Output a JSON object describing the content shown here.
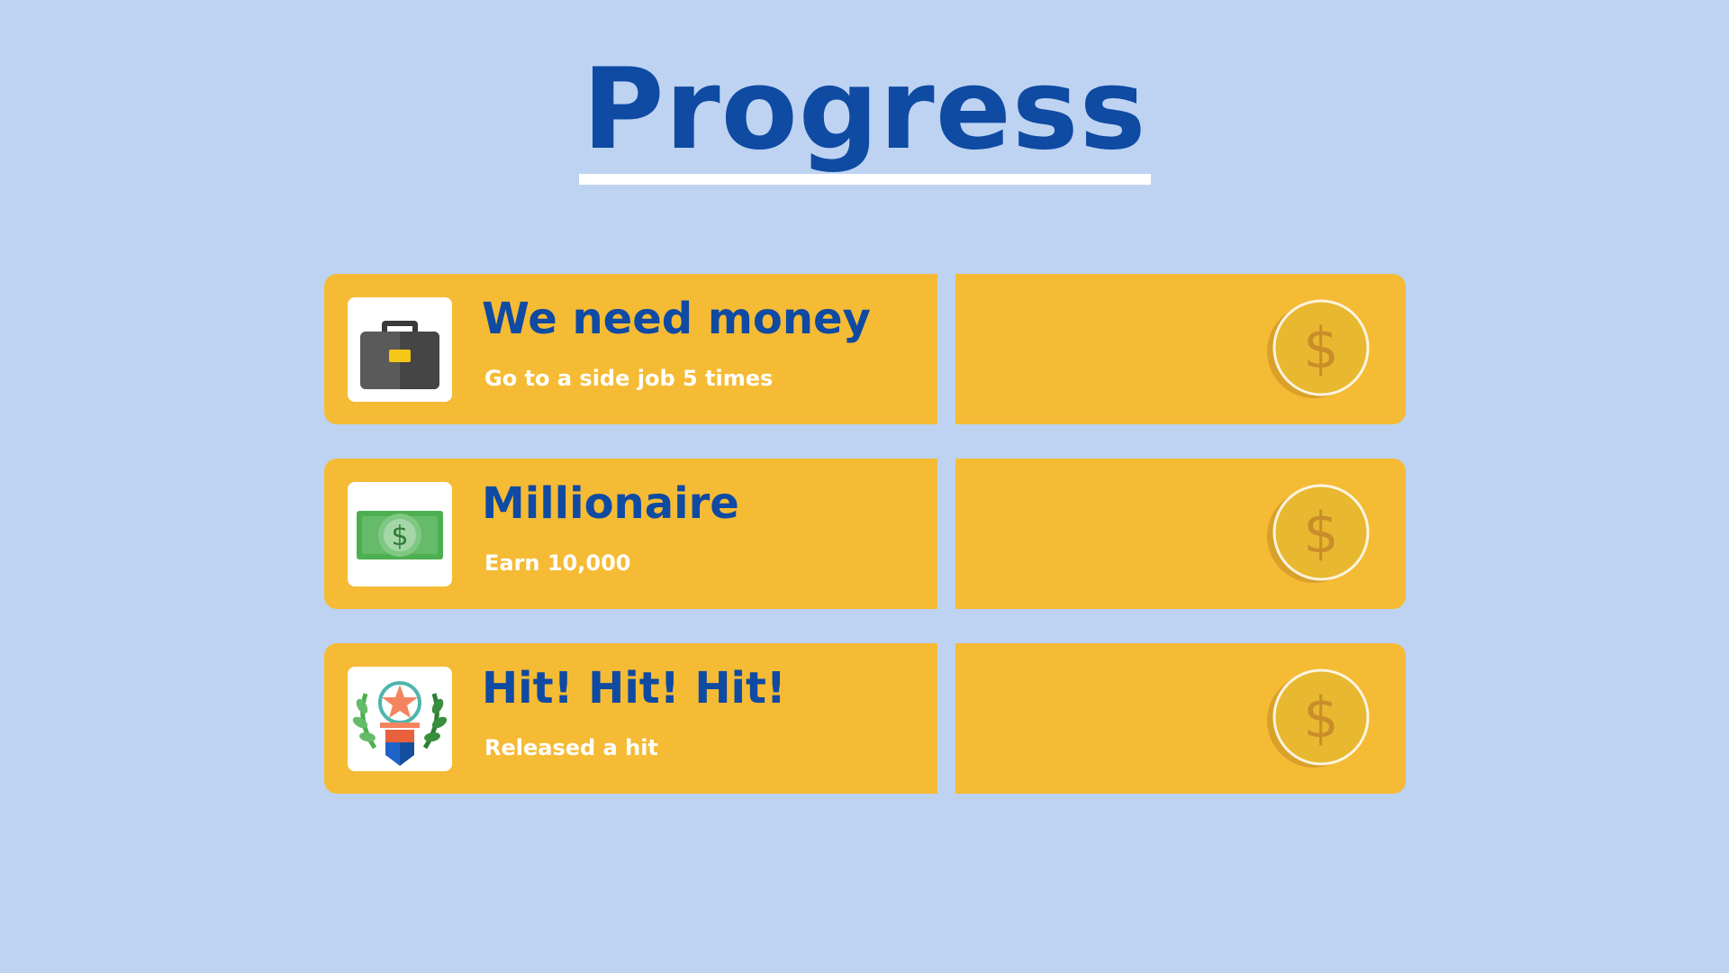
{
  "screen": {
    "title": "Progress"
  },
  "achievements": [
    {
      "title": "We need money",
      "description": "Go to a side job 5 times",
      "icon": "briefcase-icon",
      "reward_icon": "coin-icon"
    },
    {
      "title": "Millionaire",
      "description": "Earn 10,000",
      "icon": "banknote-icon",
      "reward_icon": "coin-icon"
    },
    {
      "title": "Hit! Hit! Hit!",
      "description": "Released a hit",
      "icon": "laurel-trophy-icon",
      "reward_icon": "coin-icon"
    }
  ],
  "colors": {
    "background": "#bdd3f1",
    "title": "#0f4aa3",
    "card": "#f5bb35",
    "coin": "#e8b830"
  }
}
